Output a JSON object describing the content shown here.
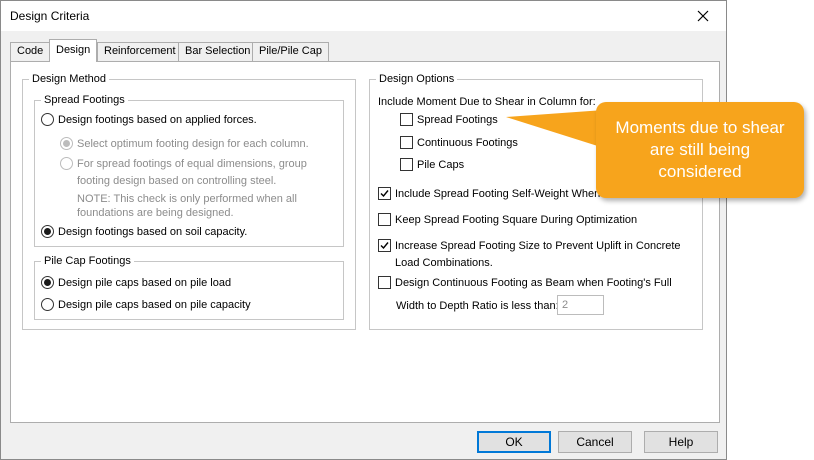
{
  "window": {
    "title": "Design Criteria"
  },
  "icons": {
    "close": "close-icon",
    "checkmark": "checkmark-icon"
  },
  "tabs": [
    {
      "label": "Code",
      "active": false
    },
    {
      "label": "Design",
      "active": true
    },
    {
      "label": "Reinforcement",
      "active": false
    },
    {
      "label": "Bar Selection",
      "active": false
    },
    {
      "label": "Pile/Pile Cap",
      "active": false
    }
  ],
  "design_method": {
    "legend": "Design Method",
    "spread_footings": {
      "legend": "Spread Footings",
      "applied_forces": {
        "label": "Design footings based on applied forces.",
        "selected": false
      },
      "optimum": {
        "label": "Select optimum footing design for each column.",
        "selected": true,
        "enabled": false
      },
      "equal_dims": {
        "line1": "For spread footings of equal dimensions, group",
        "line2": "footing design based on controlling steel.",
        "selected": false,
        "enabled": false
      },
      "note": {
        "line1": "NOTE: This check is only performed when all",
        "line2": "foundations are being designed."
      },
      "soil_capacity": {
        "label": "Design footings based on soil capacity.",
        "selected": true
      }
    },
    "pile_cap_footings": {
      "legend": "Pile Cap Footings",
      "pile_load": {
        "label": "Design pile caps based on pile load",
        "selected": true
      },
      "pile_capacity": {
        "label": "Design pile caps based on pile capacity",
        "selected": false
      }
    }
  },
  "design_options": {
    "legend": "Design Options",
    "include_moment_label": "Include Moment Due to Shear in Column for:",
    "spread_footings": {
      "label": "Spread Footings",
      "checked": false
    },
    "continuous_footings": {
      "label": "Continuous Footings",
      "checked": false
    },
    "pile_caps": {
      "label": "Pile Caps",
      "checked": false
    },
    "self_weight": {
      "label": "Include Spread Footing Self-Weight When Ca",
      "checked": true
    },
    "keep_square": {
      "label": "Keep Spread Footing Square During Optimization",
      "checked": false
    },
    "increase_size": {
      "line1": "Increase Spread Footing Size to Prevent Uplift in Concrete",
      "line2": "Load Combinations.",
      "checked": true
    },
    "continuous_beam": {
      "label": "Design Continuous Footing as Beam when Footing's Full",
      "checked": false
    },
    "width_depth": {
      "label": "Width to Depth Ratio is less than:",
      "value": "2"
    }
  },
  "buttons": {
    "ok": "OK",
    "cancel": "Cancel",
    "help": "Help"
  },
  "callout": {
    "text": "Moments due to shear are still being considered",
    "color": "#f7a41c"
  },
  "colors": {
    "accent": "#0078d7",
    "disabled_text": "#8c8c8c"
  }
}
